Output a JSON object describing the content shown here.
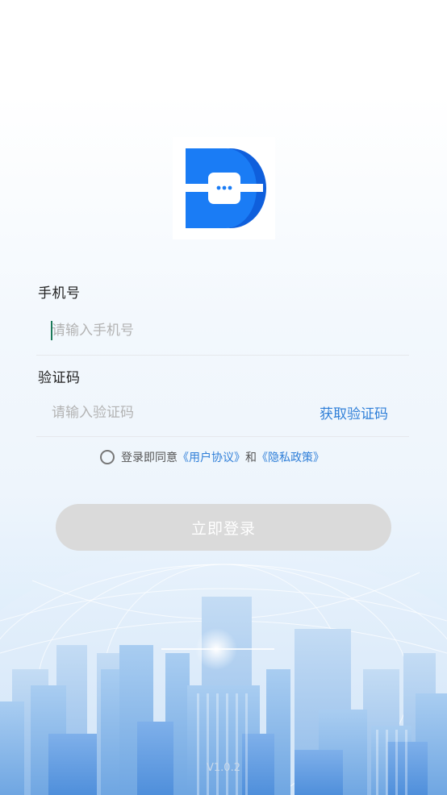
{
  "form": {
    "phone_label": "手机号",
    "phone_placeholder": "请输入手机号",
    "code_label": "验证码",
    "code_placeholder": "请输入验证码",
    "get_code_label": "获取验证码"
  },
  "agreement": {
    "prefix": "登录即同意",
    "user_agreement": "《用户协议》",
    "and": "和",
    "privacy_policy": "《隐私政策》"
  },
  "login_button_label": "立即登录",
  "version": "V1.0.2",
  "logo": {
    "icon": "app-logo-d-icon",
    "colors": {
      "primary": "#1a7cf5",
      "secondary": "#0f5fdc"
    }
  },
  "colors": {
    "accent": "#2f7fd8",
    "button_disabled": "#dadada"
  }
}
